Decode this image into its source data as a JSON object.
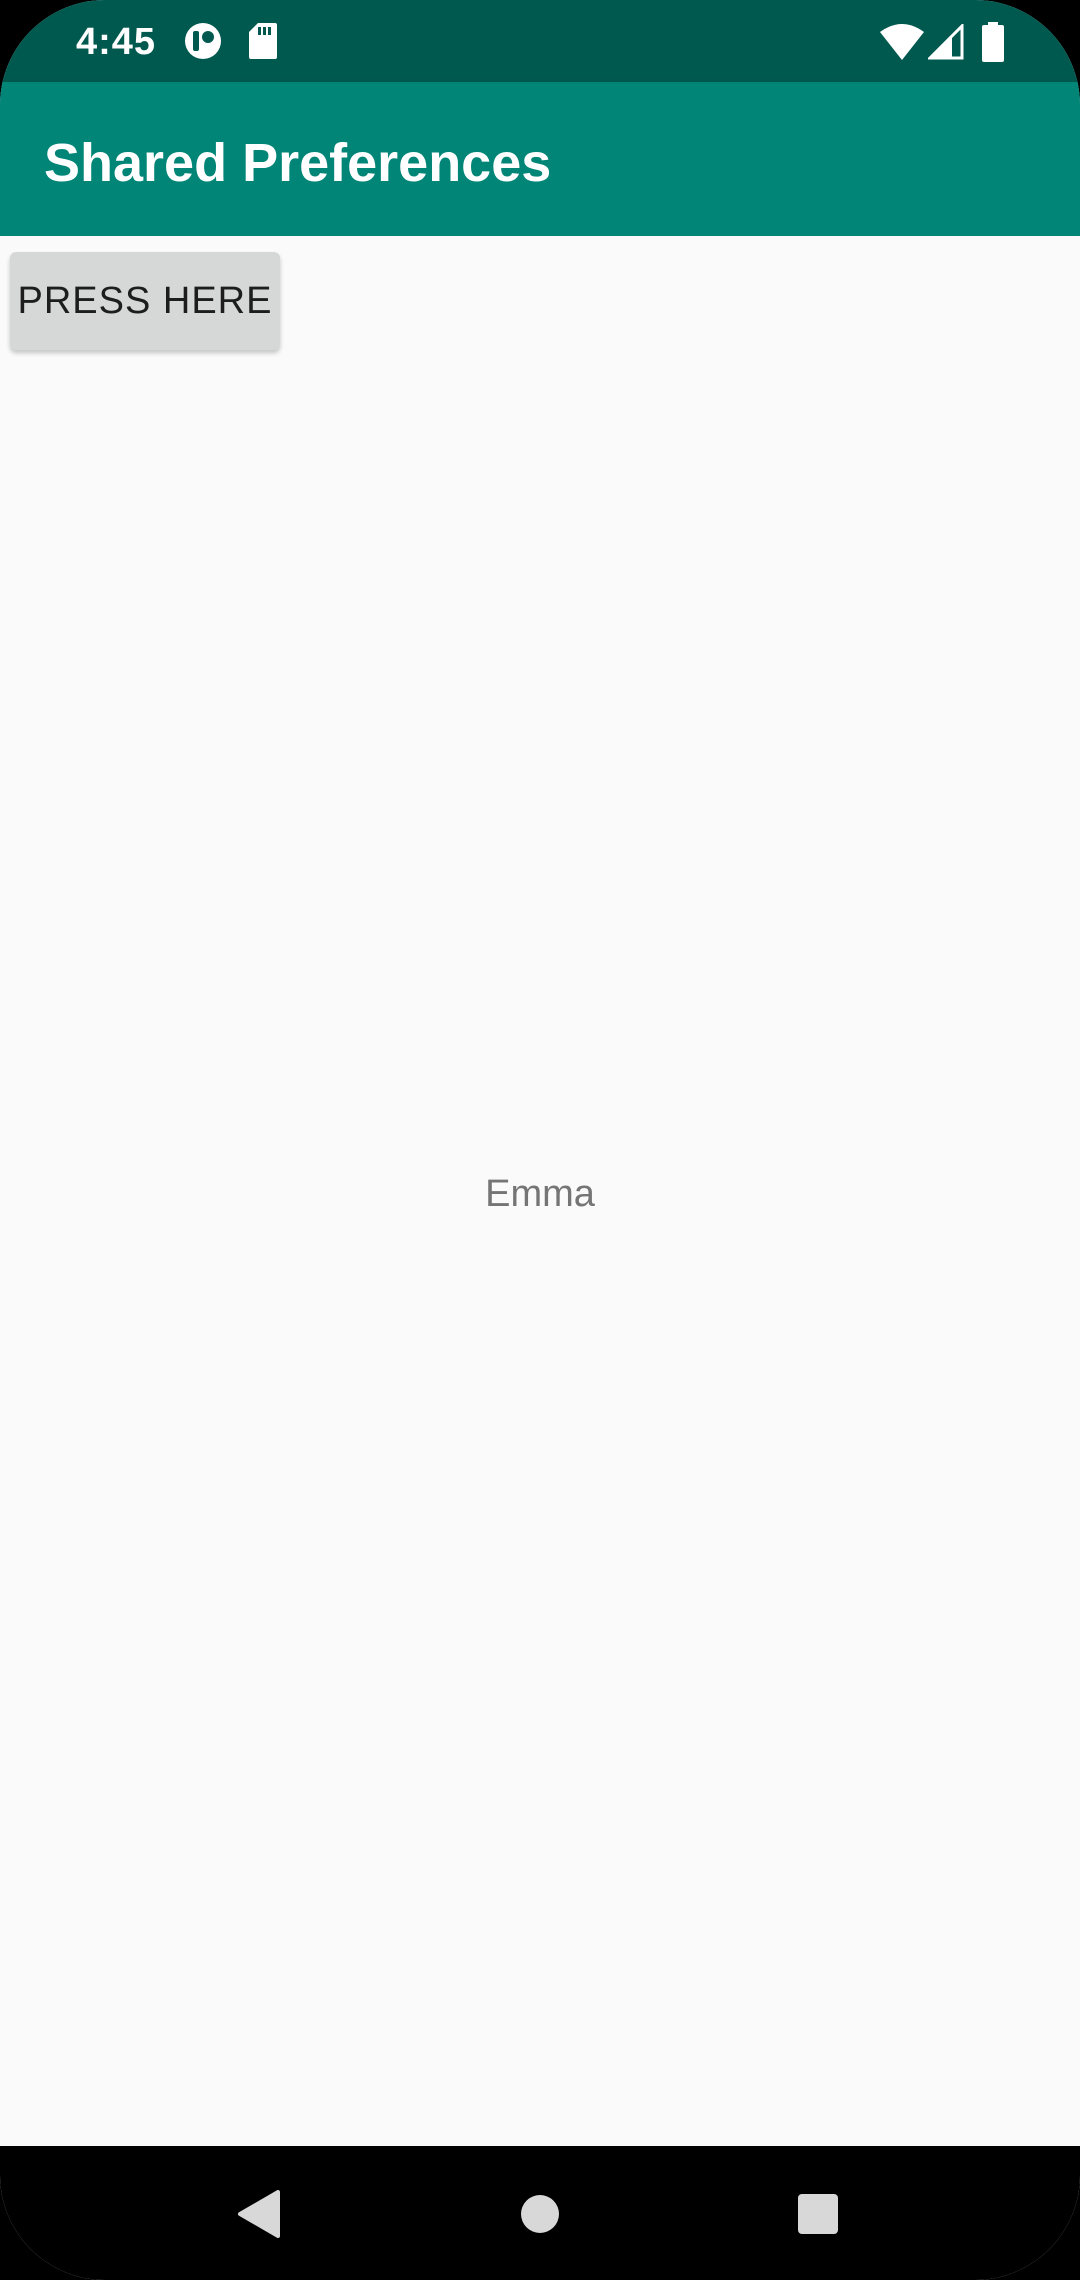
{
  "status_bar": {
    "time": "4:45",
    "left_icons": [
      "circle-logo-icon",
      "sd-card-icon"
    ],
    "right_icons": [
      "wifi-icon",
      "cell-signal-icon",
      "battery-icon"
    ],
    "color": "#00594f"
  },
  "app_bar": {
    "title": "Shared Preferences",
    "color": "#008577"
  },
  "main": {
    "button_label": "PRESS HERE",
    "saved_name": "Emma"
  },
  "nav_bar": {
    "buttons": [
      "back-icon",
      "home-icon",
      "recents-icon"
    ]
  }
}
